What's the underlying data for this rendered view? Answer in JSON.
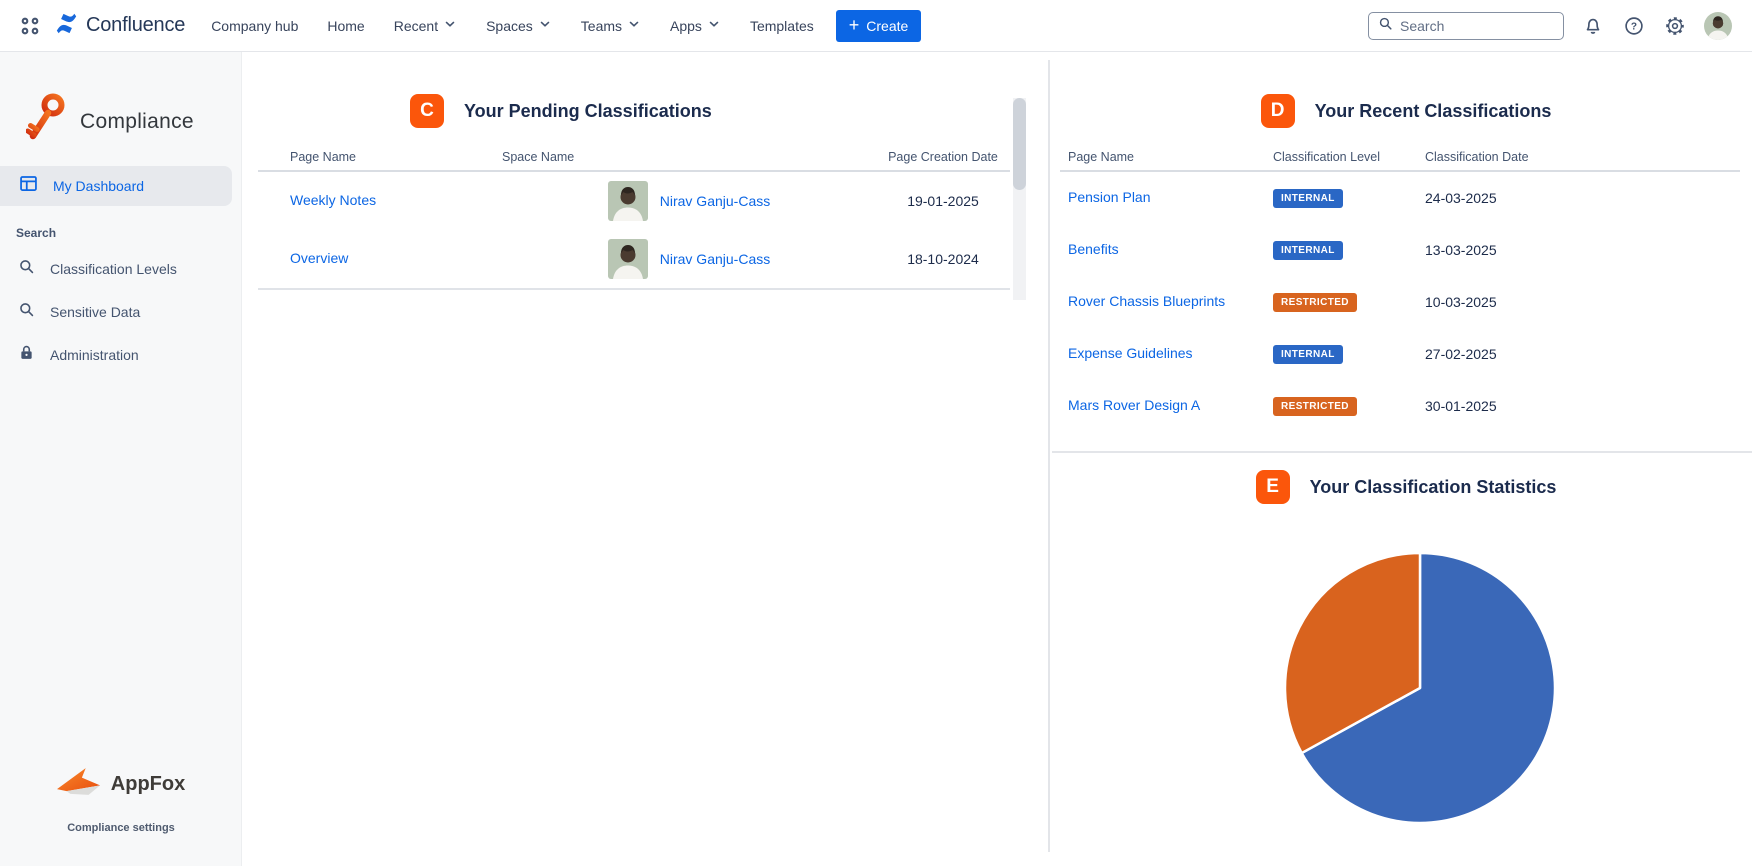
{
  "topnav": {
    "logo_text": "Confluence",
    "items": [
      "Company hub",
      "Home",
      "Recent",
      "Spaces",
      "Teams",
      "Apps",
      "Templates"
    ],
    "dropdown_items": [
      "Recent",
      "Spaces",
      "Teams",
      "Apps"
    ],
    "create_label": "Create",
    "create_plus": "+",
    "search_placeholder": "Search",
    "icons": [
      "app-switcher-grid-icon",
      "confluence-logo-icon",
      "search-icon",
      "bell-icon",
      "question-icon",
      "gear-icon",
      "avatar"
    ]
  },
  "sidebar": {
    "app_title": "Compliance",
    "app_logo_icon": "key-icon",
    "dashboard_item": "My Dashboard",
    "dashboard_icon": "dashboard-icon",
    "section_label": "Search",
    "items": [
      {
        "label": "Classification Levels",
        "icon": "magnifier-icon"
      },
      {
        "label": "Sensitive Data",
        "icon": "magnifier-icon"
      },
      {
        "label": "Administration",
        "icon": "lock-icon"
      }
    ],
    "footer_logo_text": "AppFox",
    "footer_logo_icon": "fox-icon",
    "footer_settings": "Compliance settings"
  },
  "pending": {
    "badge": "C",
    "title": "Your Pending Classifications",
    "columns": [
      "Page Name",
      "Space Name",
      "Page Creation Date"
    ],
    "rows": [
      {
        "page": "Weekly Notes",
        "space": "Nirav Ganju-Cass",
        "date": "19-01-2025"
      },
      {
        "page": "Overview",
        "space": "Nirav Ganju-Cass",
        "date": "18-10-2024"
      }
    ]
  },
  "recent": {
    "badge": "D",
    "title": "Your Recent Classifications",
    "columns": [
      "Page Name",
      "Classification Level",
      "Classification Date"
    ],
    "rows": [
      {
        "page": "Pension Plan",
        "level": "INTERNAL",
        "level_color": "#2a67c5",
        "date": "24-03-2025"
      },
      {
        "page": "Benefits",
        "level": "INTERNAL",
        "level_color": "#2a67c5",
        "date": "13-03-2025"
      },
      {
        "page": "Rover Chassis Blueprints",
        "level": "RESTRICTED",
        "level_color": "#d8641f",
        "date": "10-03-2025"
      },
      {
        "page": "Expense Guidelines",
        "level": "INTERNAL",
        "level_color": "#2a67c5",
        "date": "27-02-2025"
      },
      {
        "page": "Mars Rover Design A",
        "level": "RESTRICTED",
        "level_color": "#d8641f",
        "date": "30-01-2025"
      }
    ]
  },
  "stats": {
    "badge": "E",
    "title": "Your Classification Statistics"
  },
  "chart_data": {
    "type": "pie",
    "title": "Your Classification Statistics",
    "slices": [
      {
        "label": "blue-segment",
        "value": 67,
        "color": "#3a68b8"
      },
      {
        "label": "orange-segment",
        "value": 33,
        "color": "#d9631e"
      }
    ],
    "start_angle_deg": 0,
    "direction": "clockwise",
    "legend": false,
    "data_labels_shown": false
  },
  "colors": {
    "accent_orange": "#fb560b",
    "link_blue": "#0c66e4",
    "internal_badge": "#2a67c5",
    "restricted_badge": "#d8641f",
    "pie_blue": "#3a68b8",
    "pie_orange": "#d9631e"
  }
}
